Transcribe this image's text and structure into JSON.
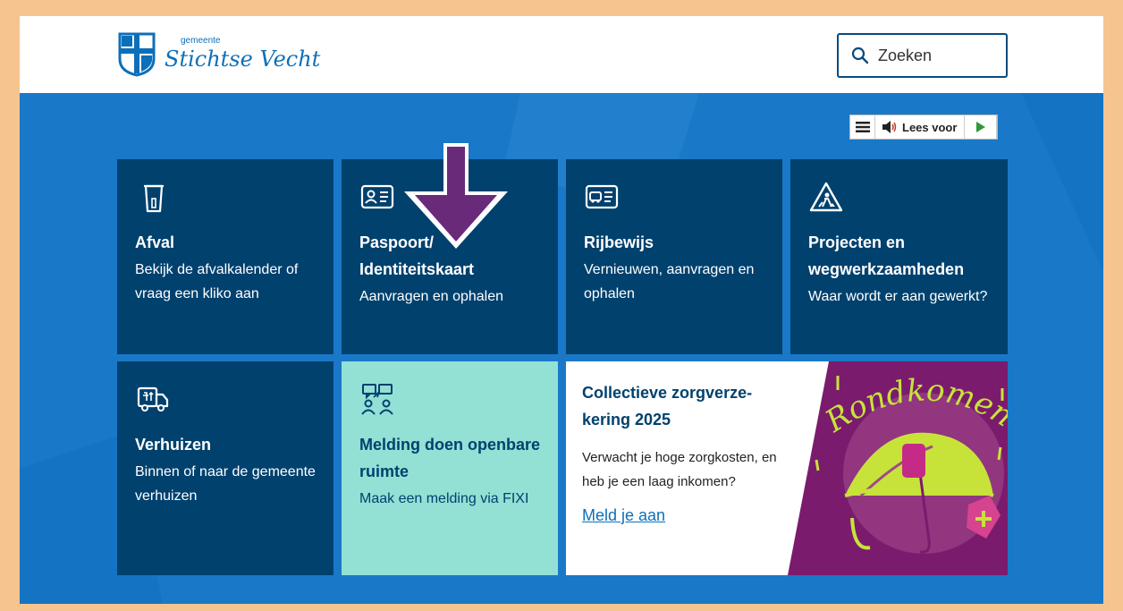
{
  "header": {
    "logo": {
      "small": "gemeente",
      "main": "Stichtse Vecht"
    },
    "search": {
      "placeholder": "Zoeken"
    }
  },
  "readbar": {
    "label": "Lees voor"
  },
  "cards": [
    {
      "icon": "trash-bin-icon",
      "title": "Afval",
      "text": "Bekijk de afvalkalender of vraag een kliko aan"
    },
    {
      "icon": "id-card-icon",
      "title": "Paspoort/ Identiteitskaart",
      "text": "Aanvragen en ophalen"
    },
    {
      "icon": "drivers-license-icon",
      "title": "Rijbewijs",
      "text": "Vernieuwen, aanvragen en ophalen"
    },
    {
      "icon": "road-works-icon",
      "title": "Projecten en wegwerkzaamheden",
      "text": "Waar wordt er aan gewerkt?"
    },
    {
      "icon": "moving-truck-icon",
      "title": "Verhuizen",
      "text": "Binnen of naar de gemeente verhuizen"
    },
    {
      "icon": "report-people-icon",
      "title": "Melding doen openbare ruimte",
      "text": "Maak een melding via FIXI"
    }
  ],
  "promo": {
    "title": "Collectieve zorgverze-kering 2025",
    "text": "Verwacht je hoge zorgkosten, en heb je een laag inkomen?",
    "link": "Meld je aan",
    "art_text": "Rondkomen"
  },
  "colors": {
    "card_dark": "#00416e",
    "card_mint": "#93e0d5",
    "hero_blue": "#1a78c8",
    "arrow_purple": "#6a2a7a",
    "promo_purple": "#7b1b6e",
    "frame": "#f6c48f"
  }
}
